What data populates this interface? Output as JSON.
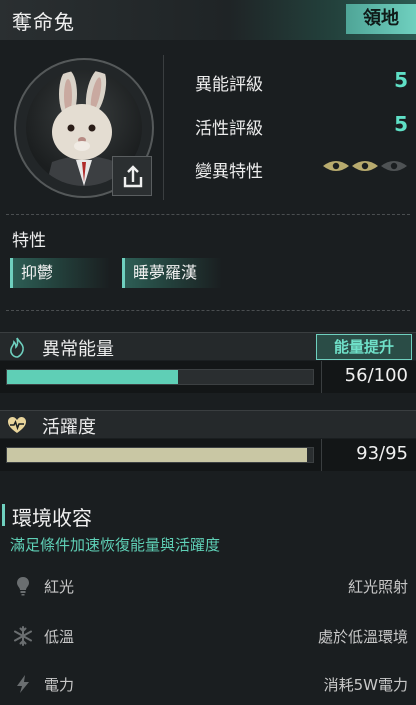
{
  "header": {
    "title": "奪命兔",
    "tag": "領地"
  },
  "stats": {
    "anomaly_rating": {
      "label": "異能評級",
      "value": "5"
    },
    "activity_rating": {
      "label": "活性評級",
      "value": "5"
    },
    "mutation": {
      "label": "變異特性",
      "level": 2,
      "max": 3
    }
  },
  "traits": {
    "title": "特性",
    "items": [
      "抑鬱",
      "睡夢羅漢"
    ]
  },
  "energy": {
    "label": "異常能量",
    "button": "能量提升",
    "value_text": "56/100",
    "fraction": 0.56
  },
  "activity": {
    "label": "活躍度",
    "value_text": "93/95",
    "fraction": 0.979
  },
  "environment": {
    "title": "環境收容",
    "subtitle": "滿足條件加速恢復能量與活躍度",
    "rows": [
      {
        "icon": "lightbulb-icon",
        "name": "紅光",
        "value": "紅光照射"
      },
      {
        "icon": "snowflake-icon",
        "name": "低溫",
        "value": "處於低溫環境"
      },
      {
        "icon": "lightning-icon",
        "name": "電力",
        "value": "消耗5W電力"
      }
    ]
  },
  "colors": {
    "accent": "#5fe0c6",
    "energy_fill": "#5fcfb6",
    "activity_fill": "#c9c7a4",
    "eye_active": "#b8ab6e"
  }
}
